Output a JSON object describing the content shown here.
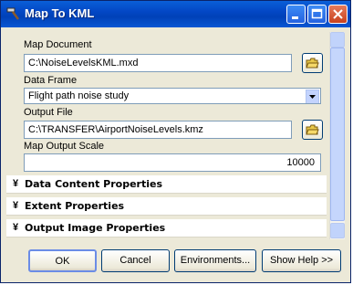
{
  "window": {
    "title": "Map To KML"
  },
  "fields": {
    "map_document": {
      "label": "Map Document",
      "value": "C:\\NoiseLevelsKML.mxd"
    },
    "data_frame": {
      "label": "Data Frame",
      "value": "Flight path noise study"
    },
    "output_file": {
      "label": "Output File",
      "value": "C:\\TRANSFER\\AirportNoiseLevels.kmz"
    },
    "map_output_scale": {
      "label": "Map Output Scale",
      "value": "10000"
    }
  },
  "sections": [
    {
      "label": "Data Content Properties"
    },
    {
      "label": "Extent Properties"
    },
    {
      "label": "Output Image Properties"
    }
  ],
  "buttons": {
    "ok": "OK",
    "cancel": "Cancel",
    "environments": "Environments...",
    "show_help": "Show Help >>"
  }
}
